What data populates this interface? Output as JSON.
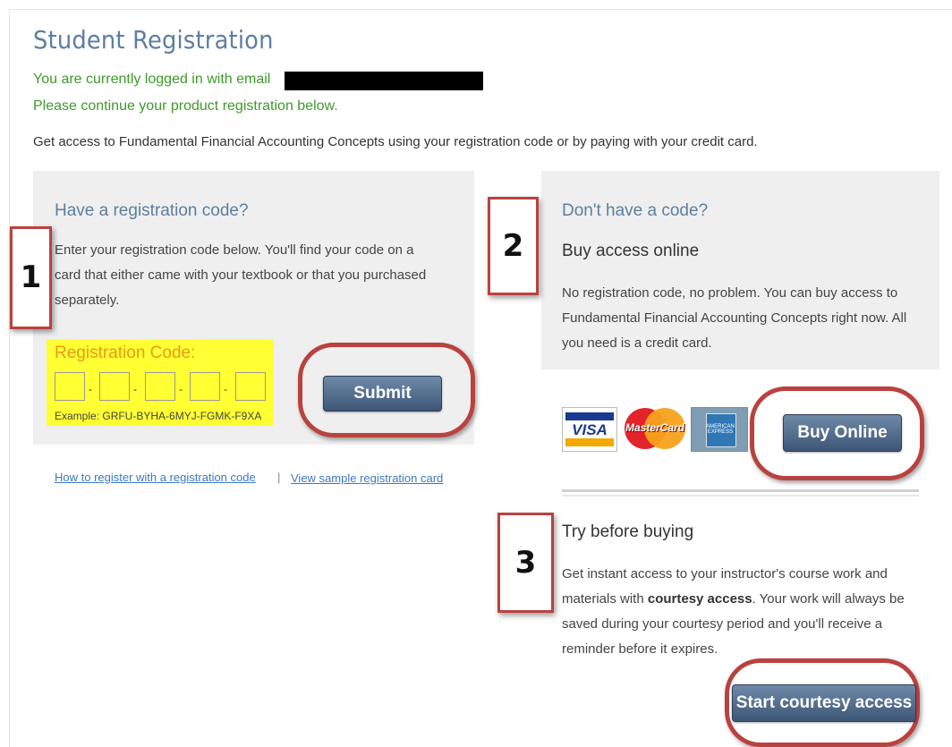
{
  "page": {
    "title": "Student Registration",
    "login_prefix": "You are currently logged in with email",
    "continue_text": "Please continue your product registration below.",
    "intro": "Get access to Fundamental Financial Accounting Concepts using your registration code or by paying with your credit card."
  },
  "colors": {
    "title": "#5d7f9e",
    "green": "#3f9a2a",
    "button": "#4a6385",
    "annotation": "#b9423f",
    "highlight": "#ffff33",
    "link": "#3b7ac2"
  },
  "code_panel": {
    "heading": "Have a registration code?",
    "body_lines": [
      "Enter your registration code below. You'll find your code on a",
      "card that either came with your textbook or that you purchased",
      "separately."
    ],
    "code_label": "Registration Code:",
    "code_fields": [
      "",
      "",
      "",
      "",
      ""
    ],
    "separator": "-",
    "example": "Example: GRFU-BYHA-6MYJ-FGMK-F9XA",
    "submit_label": "Submit"
  },
  "links": {
    "how_to": "How to register with a registration code",
    "separator": "|",
    "sample": "View sample registration card"
  },
  "buy_panel": {
    "heading": "Don't have a code?",
    "subheading": "Buy access online",
    "body_lines": [
      "No registration code, no problem. You can buy access to",
      "Fundamental Financial Accounting Concepts right now. All",
      "you need is a credit card."
    ],
    "cards": [
      {
        "name": "VISA",
        "icon": "visa-card-icon"
      },
      {
        "name": "MasterCard",
        "icon": "mastercard-icon"
      },
      {
        "name": "AMERICAN EXPRESS",
        "icon": "amex-card-icon"
      }
    ],
    "buy_label": "Buy Online"
  },
  "trial_panel": {
    "heading": "Try before buying",
    "line1": "Get instant access to your instructor's course work and",
    "line2_pre": "materials with ",
    "line2_bold": "courtesy access",
    "line2_post": ". Your work will always be",
    "line3": "saved during your courtesy period and you'll receive a",
    "line4": "reminder before it expires.",
    "button_label": "Start courtesy access"
  },
  "annotations": {
    "step1": "1",
    "step2": "2",
    "step3": "3"
  }
}
